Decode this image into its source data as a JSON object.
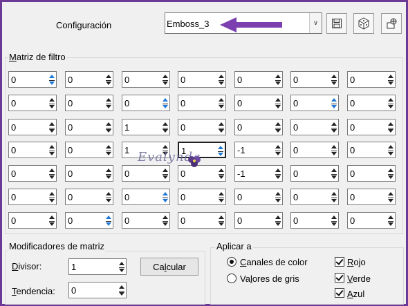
{
  "toolbar": {
    "config_label": "Configuración",
    "preset_value": "Emboss_3",
    "save_icon": "save-icon",
    "random_icon": "dice-icon",
    "presets_icon": "preset-manager-icon"
  },
  "filter_matrix": {
    "title_access": "M",
    "title_rest": "atriz de filtro",
    "rows": [
      [
        "0",
        "0",
        "0",
        "0",
        "0",
        "0",
        "0"
      ],
      [
        "0",
        "0",
        "0",
        "0",
        "0",
        "0",
        "0"
      ],
      [
        "0",
        "0",
        "1",
        "0",
        "0",
        "0",
        "0"
      ],
      [
        "0",
        "0",
        "1",
        "1",
        "-1",
        "0",
        "0"
      ],
      [
        "0",
        "0",
        "0",
        "0",
        "-1",
        "0",
        "0"
      ],
      [
        "0",
        "0",
        "0",
        "0",
        "0",
        "0",
        "0"
      ],
      [
        "0",
        "0",
        "0",
        "0",
        "0",
        "0",
        "0"
      ]
    ]
  },
  "watermark": {
    "text": "Evalynda"
  },
  "modifiers": {
    "title": "Modificadores de matriz",
    "divisor_access": "D",
    "divisor_rest": "ivisor:",
    "divisor_value": "1",
    "tendency_access": "T",
    "tendency_rest": "endencia:",
    "tendency_value": "0",
    "calc_pre": "Ca",
    "calc_access": "l",
    "calc_post": "cular"
  },
  "apply": {
    "title": "Aplicar a",
    "radio_color_access": "C",
    "radio_color_rest": "anales de color",
    "radio_color_selected": true,
    "radio_gray_pre": "Va",
    "radio_gray_access": "l",
    "radio_gray_post": "ores de gris",
    "radio_gray_selected": false,
    "check_red_access": "R",
    "check_red_rest": "ojo",
    "check_red_checked": true,
    "check_green_access": "V",
    "check_green_rest": "erde",
    "check_green_checked": true,
    "check_blue_access": "A",
    "check_blue_rest": "zul",
    "check_blue_checked": true
  },
  "colors": {
    "frame_border": "#6a3a96",
    "annotation_arrow": "#7b3fb0",
    "spinner_highlight": "#1e78d6"
  }
}
